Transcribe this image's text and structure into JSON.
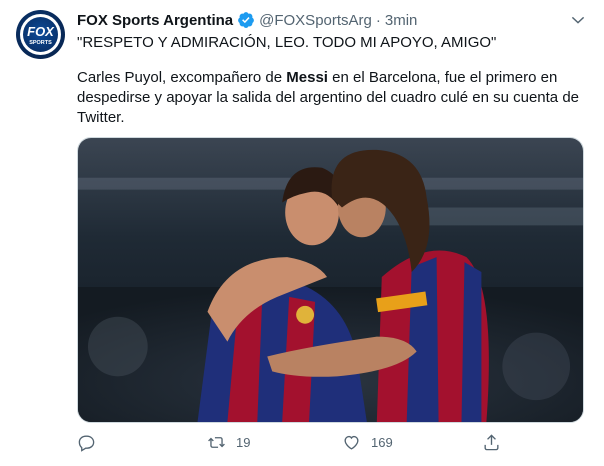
{
  "account": {
    "name": "FOX Sports Argentina",
    "handle": "@FOXSportsArg",
    "separator": "·",
    "time": "3min",
    "avatar_text_top": "FOX",
    "avatar_text_bottom": "SPORTS"
  },
  "tweet": {
    "headline": "\"RESPETO Y ADMIRACIÓN, LEO. TODO MI APOYO, AMIGO\"",
    "body_before": "Carles Puyol, excompañero de ",
    "body_bold": "Messi",
    "body_after": " en el Barcelona, fue el primero en despedirse y apoyar la salida del argentino del cuadro culé en su cuenta de Twitter."
  },
  "actions": {
    "reply_count": "",
    "retweet_count": "19",
    "like_count": "169",
    "share_count": ""
  },
  "icons": {
    "verified": "verified-badge-icon",
    "more": "chevron-down-icon",
    "reply": "reply-icon",
    "retweet": "retweet-icon",
    "like": "heart-icon",
    "share": "share-icon"
  },
  "colors": {
    "verified": "#1d9bf0",
    "muted": "#536471",
    "text": "#0f1419",
    "border": "#cfd9de"
  }
}
